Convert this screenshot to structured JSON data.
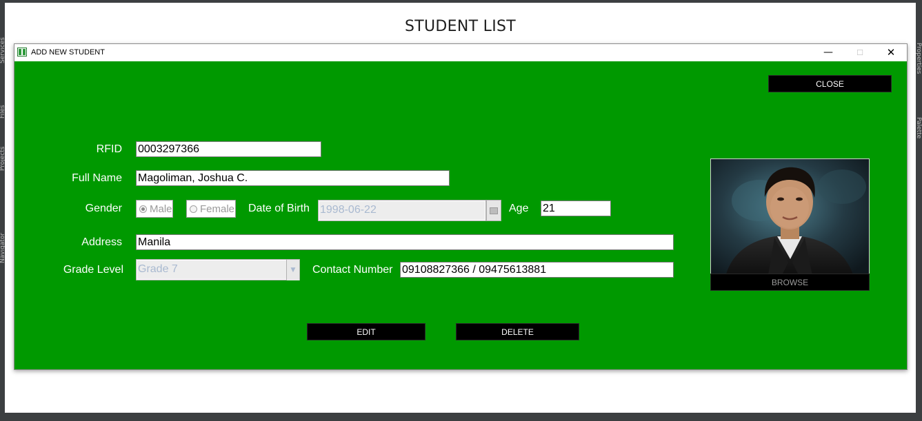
{
  "ide": {
    "left_tabs": [
      "Services",
      "Files",
      "Projects",
      "Navigator"
    ],
    "right_tabs": [
      "Properties",
      "Palette"
    ]
  },
  "parent": {
    "title": "STUDENT LIST"
  },
  "dialog": {
    "title": "ADD NEW STUDENT",
    "minimize_glyph": "—",
    "maximize_glyph": "☐",
    "close_glyph": "✕"
  },
  "form": {
    "rfid_label": "RFID",
    "rfid_value": "0003297366",
    "fullname_label": "Full Name",
    "fullname_value": "Magoliman, Joshua  C.",
    "gender_label": "Gender",
    "gender_options": [
      "Male",
      "Female"
    ],
    "gender_selected": "Male",
    "dob_label": "Date of Birth",
    "dob_value": "1998-06-22",
    "age_label": "Age",
    "age_value": "21",
    "address_label": "Address",
    "address_value": "Manila",
    "grade_label": "Grade Level",
    "grade_value": "Grade 7",
    "contact_label": "Contact Number",
    "contact_value": "09108827366 / 09475613881"
  },
  "buttons": {
    "close": "CLOSE",
    "browse": "BROWSE",
    "edit": "EDIT",
    "delete": "DELETE"
  },
  "colors": {
    "panel_bg": "#009900",
    "button_bg": "#000000",
    "disabled_text": "#a9b9d0"
  }
}
